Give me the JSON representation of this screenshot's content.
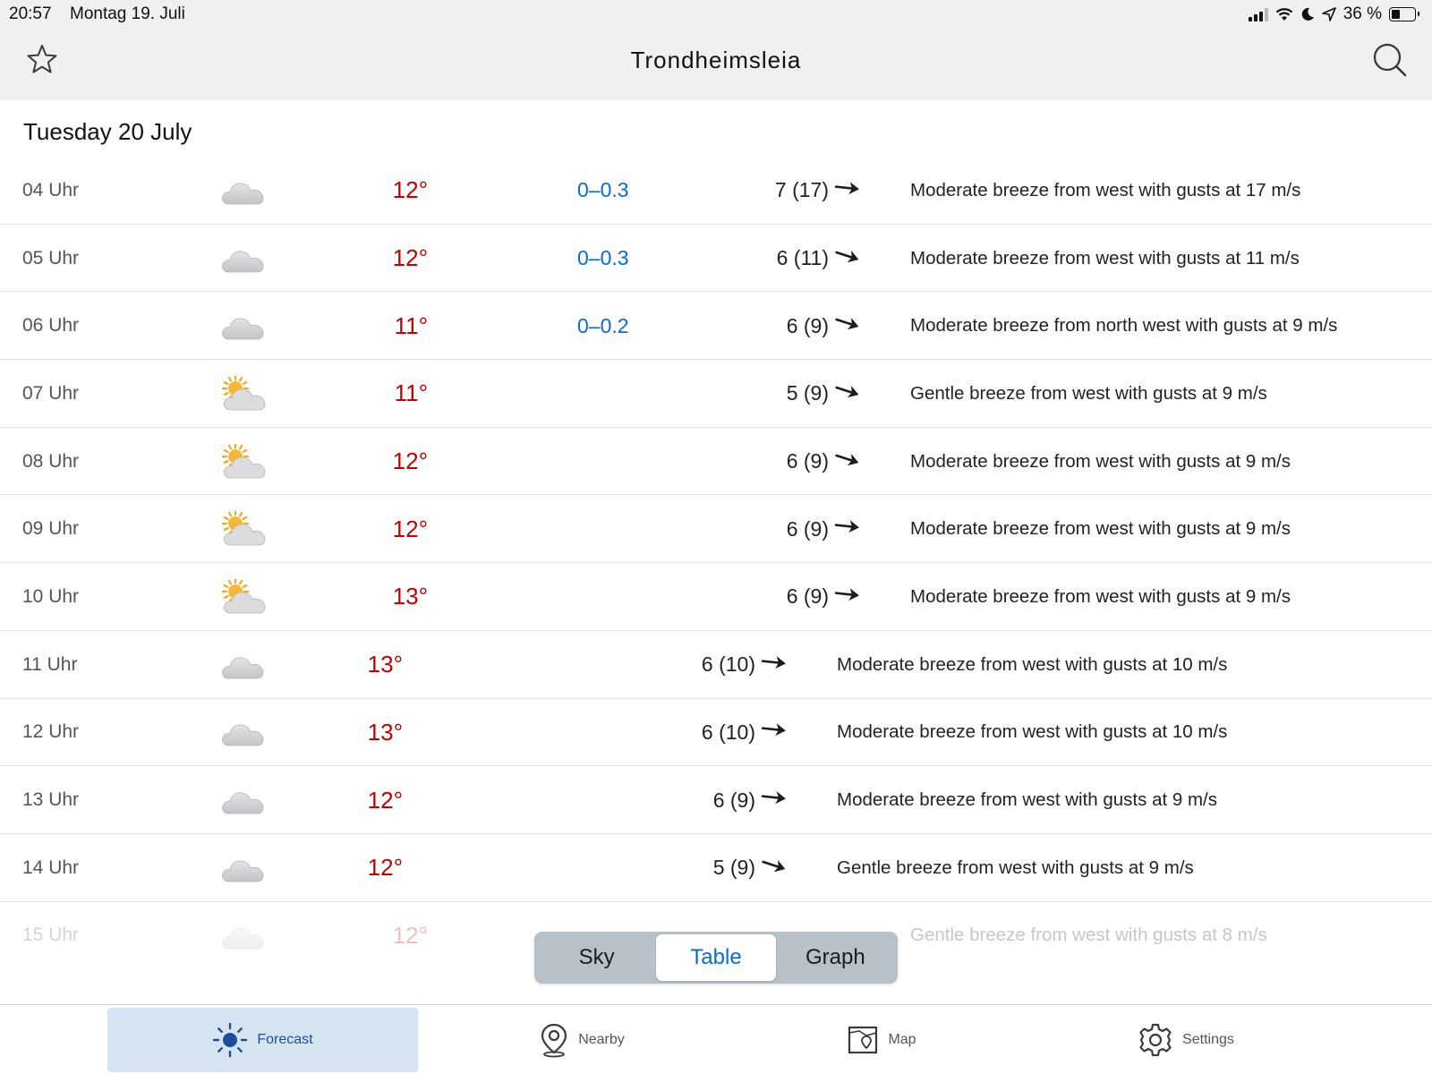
{
  "status_bar": {
    "time": "20:57",
    "date": "Montag 19. Juli",
    "battery": "36 %",
    "battery_level": 0.36
  },
  "header": {
    "title": "Trondheimsleia"
  },
  "day_title": "Tuesday 20 July",
  "rows": [
    {
      "time": "04 Uhr",
      "icon": "cloud-icon",
      "temp": "12°",
      "precip": "0–0.3",
      "wind": "7 (17)",
      "desc": "Moderate breeze from west with gusts at 17 m/s"
    },
    {
      "time": "05 Uhr",
      "icon": "cloud-icon",
      "temp": "12°",
      "precip": "0–0.3",
      "wind": "6 (11)",
      "desc": "Moderate breeze from west with gusts at 11 m/s"
    },
    {
      "time": "06 Uhr",
      "icon": "cloud-icon",
      "temp": "11°",
      "precip": "0–0.2",
      "wind": "6 (9)",
      "desc": "Moderate breeze from north west with gusts at 9 m/s"
    },
    {
      "time": "07 Uhr",
      "icon": "partly-cloudy-icon",
      "temp": "11°",
      "precip": "",
      "wind": "5 (9)",
      "desc": "Gentle breeze from west with gusts at 9 m/s"
    },
    {
      "time": "08 Uhr",
      "icon": "partly-cloudy-icon",
      "temp": "12°",
      "precip": "",
      "wind": "6 (9)",
      "desc": "Moderate breeze from west with gusts at 9 m/s"
    },
    {
      "time": "09 Uhr",
      "icon": "partly-cloudy-icon",
      "temp": "12°",
      "precip": "",
      "wind": "6 (9)",
      "desc": "Moderate breeze from west with gusts at 9 m/s"
    },
    {
      "time": "10 Uhr",
      "icon": "partly-cloudy-icon",
      "temp": "13°",
      "precip": "",
      "wind": "6 (9)",
      "desc": "Moderate breeze from west with gusts at 9 m/s"
    },
    {
      "time": "11 Uhr",
      "icon": "cloud-icon",
      "temp": "13°",
      "precip": "",
      "wind": "6 (10)",
      "desc": "Moderate breeze from west with gusts at 10 m/s"
    },
    {
      "time": "12 Uhr",
      "icon": "cloud-icon",
      "temp": "13°",
      "precip": "",
      "wind": "6 (10)",
      "desc": "Moderate breeze from west with gusts at 10 m/s"
    },
    {
      "time": "13 Uhr",
      "icon": "cloud-icon",
      "temp": "12°",
      "precip": "",
      "wind": "6 (9)",
      "desc": "Moderate breeze from west with gusts at 9 m/s"
    },
    {
      "time": "14 Uhr",
      "icon": "cloud-icon",
      "temp": "12°",
      "precip": "",
      "wind": "5 (9)",
      "desc": "Gentle breeze from west with gusts at 9 m/s"
    },
    {
      "time": "15 Uhr",
      "icon": "cloud-icon",
      "temp": "12°",
      "precip": "",
      "wind": "",
      "desc": "Gentle breeze from west with gusts at 8 m/s"
    }
  ],
  "segmented": {
    "sky": "Sky",
    "table": "Table",
    "graph": "Graph",
    "selected": "Table"
  },
  "tabs": {
    "forecast": "Forecast",
    "nearby": "Nearby",
    "map": "Map",
    "settings": "Settings",
    "active": "Forecast"
  },
  "colors": {
    "temp": "#c60000",
    "precip": "#0b6bd0",
    "accent": "#0b6bd0",
    "active_tab_bg": "#d6e4f2"
  }
}
